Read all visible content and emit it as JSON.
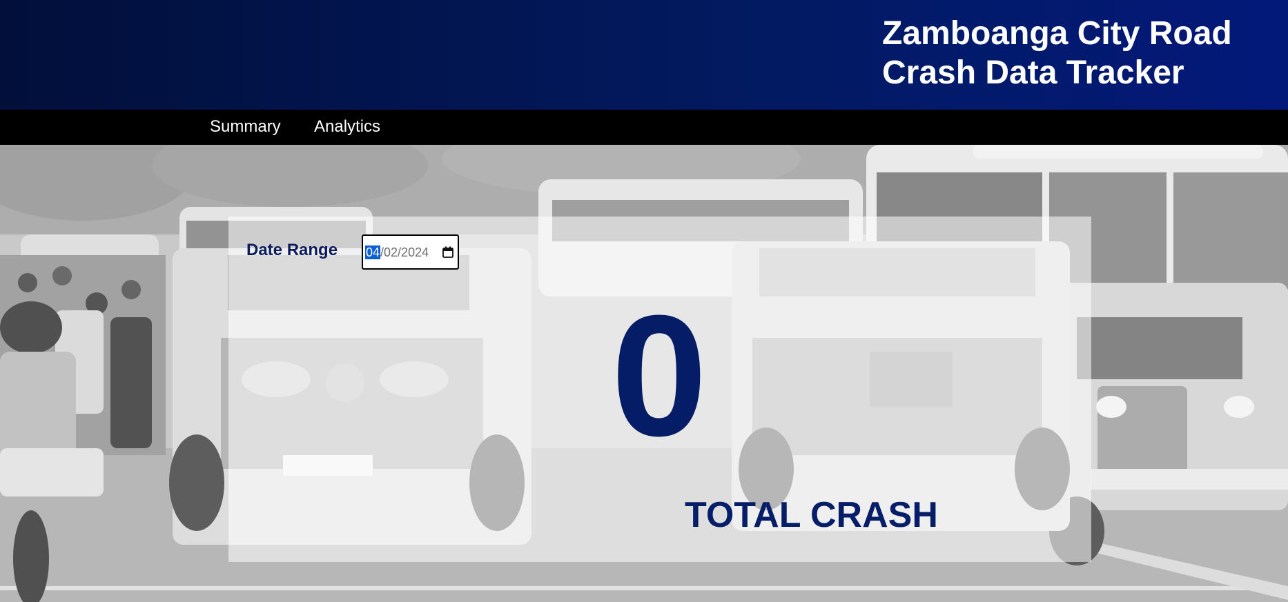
{
  "header": {
    "title": "Zamboanga City Road\nCrash Data Tracker"
  },
  "nav": {
    "items": [
      {
        "label": "Summary"
      },
      {
        "label": "Analytics"
      }
    ]
  },
  "filter": {
    "label": "Date Range",
    "date": {
      "month": "04",
      "rest": "/02/2024"
    }
  },
  "stats": {
    "total_value": "0",
    "total_label": "TOTAL CRASH"
  },
  "colors": {
    "header_bg": "#021a62",
    "navbar_bg": "#000000",
    "accent_text": "#051c66",
    "date_highlight": "#0a5fd1"
  },
  "icons": {
    "date_picker": "calendar-icon"
  },
  "background": "grayscale photo of traffic with jeepneys, buses, motorcyclists and pedestrians"
}
